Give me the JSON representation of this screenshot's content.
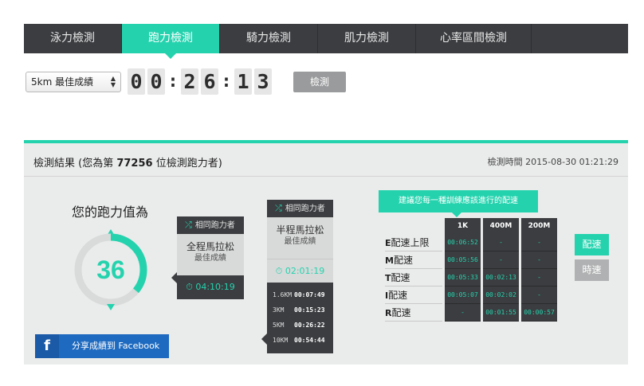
{
  "tabs": [
    {
      "label": "泳力檢測",
      "active": false
    },
    {
      "label": "跑力檢測",
      "active": true
    },
    {
      "label": "騎力檢測",
      "active": false
    },
    {
      "label": "肌力檢測",
      "active": false
    },
    {
      "label": "心率區間檢測",
      "active": false
    }
  ],
  "controls": {
    "distance_select": "5km 最佳成績",
    "timer_digits": [
      "0",
      "0",
      "2",
      "6",
      "1",
      "3"
    ],
    "detect_label": "檢測"
  },
  "result": {
    "title_prefix": "檢測結果 (您為第 ",
    "rank": "77256",
    "title_suffix": " 位檢測跑力者)",
    "time_label": "檢測時間 2015-08-30 01:21:29",
    "score_title": "您的跑力值為",
    "score_value": "36",
    "score_fraction": 0.36,
    "facebook_icon": "f",
    "facebook_label": "分享成績到 Facebook"
  },
  "marathon_card": {
    "header": "相同跑力者",
    "line1": "全程馬拉松",
    "line2": "最佳成績",
    "time": "04:10:19"
  },
  "half_card": {
    "header": "相同跑力者",
    "line1": "半程馬拉松",
    "line2": "最佳成績",
    "time": "02:01:19",
    "splits": [
      {
        "dist": "1.6KM",
        "time": "00:07:49"
      },
      {
        "dist": "3KM",
        "time": "00:15:23"
      },
      {
        "dist": "5KM",
        "time": "00:26:22"
      },
      {
        "dist": "10KM",
        "time": "00:54:44"
      }
    ]
  },
  "pace": {
    "title": "建議您每一種訓練應該進行的配速",
    "columns": [
      "1K",
      "400M",
      "200M"
    ],
    "rows": [
      {
        "letter": "E",
        "name": "配速上限",
        "values": [
          "00:06:52",
          "-",
          "-"
        ]
      },
      {
        "letter": "M",
        "name": "配速",
        "values": [
          "00:05:56",
          "-",
          "-"
        ]
      },
      {
        "letter": "T",
        "name": "配速",
        "values": [
          "00:05:33",
          "00:02:13",
          "-"
        ]
      },
      {
        "letter": "I",
        "name": "配速",
        "values": [
          "00:05:07",
          "00:02:02",
          "-"
        ]
      },
      {
        "letter": "R",
        "name": "配速",
        "values": [
          "-",
          "00:01:55",
          "00:00:57"
        ]
      }
    ],
    "toggle_on": "配速",
    "toggle_off": "時速"
  },
  "colors": {
    "accent": "#24d3ae",
    "dark": "#3b3d40",
    "facebook": "#1e6ac0",
    "panel": "#eaebeb"
  },
  "icons": [
    "shuffle-icon",
    "stopwatch-icon",
    "facebook-icon",
    "chevron-up-icon",
    "chevron-down-icon"
  ]
}
